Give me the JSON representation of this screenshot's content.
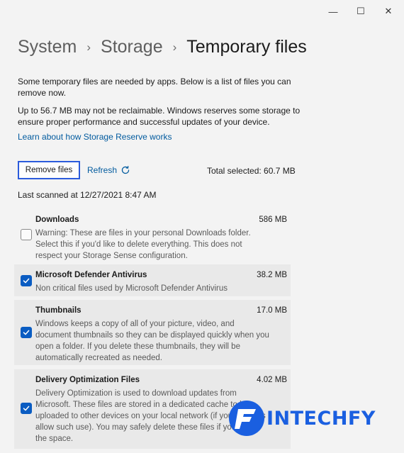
{
  "window": {
    "minimize_glyph": "—",
    "maximize_glyph": "☐",
    "close_glyph": "✕"
  },
  "breadcrumb": {
    "items": [
      "System",
      "Storage"
    ],
    "current": "Temporary files",
    "separator": "›"
  },
  "intro": {
    "line1": "Some temporary files are needed by apps. Below is a list of files you can remove now.",
    "line2": "Up to 56.7 MB may not be reclaimable. Windows reserves some storage to ensure proper performance and successful updates of your device.",
    "learn_link": "Learn about how Storage Reserve works"
  },
  "actions": {
    "remove_label": "Remove files",
    "refresh_label": "Refresh",
    "total_selected": "Total selected: 60.7 MB"
  },
  "last_scanned": "Last scanned at 12/27/2021 8:47 AM",
  "items": [
    {
      "title": "Downloads",
      "size": "586 MB",
      "checked": false,
      "description": "Warning: These are files in your personal Downloads folder. Select this if you'd like to delete everything. This does not respect your Storage Sense configuration."
    },
    {
      "title": "Microsoft Defender Antivirus",
      "size": "38.2 MB",
      "checked": true,
      "description": "Non critical files used by Microsoft Defender Antivirus"
    },
    {
      "title": "Thumbnails",
      "size": "17.0 MB",
      "checked": true,
      "description": "Windows keeps a copy of all of your picture, video, and document thumbnails so they can be displayed quickly when you open a folder. If you delete these thumbnails, they will be automatically recreated as needed."
    },
    {
      "title": "Delivery Optimization Files",
      "size": "4.02 MB",
      "checked": true,
      "description": "Delivery Optimization is used to download updates from Microsoft. These files are stored in a dedicated cache to be uploaded to other devices on your local network (if your settings allow such use). You may safely delete these files if you need the space."
    }
  ],
  "watermark": {
    "text": "INTECHFY",
    "color": "#1a5fe0"
  },
  "colors": {
    "accent": "#0a5cc2",
    "link": "#005a9e",
    "focus_border": "#2b5bdc"
  }
}
